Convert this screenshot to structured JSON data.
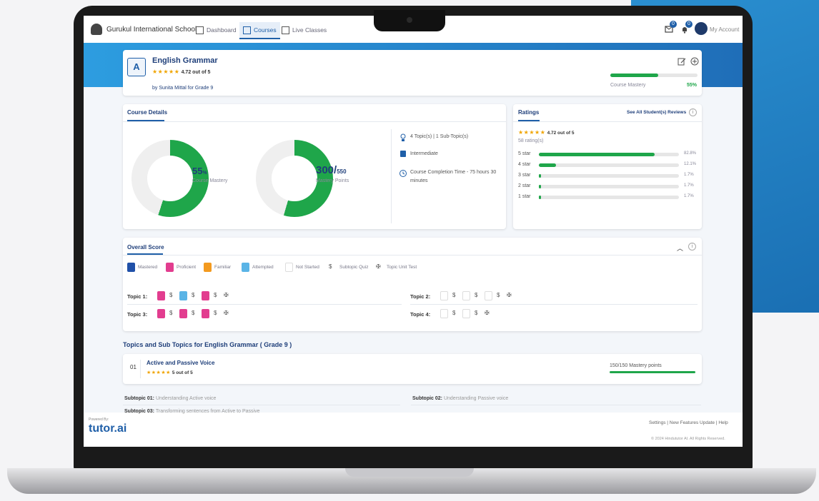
{
  "topbar": {
    "school_name": "Gurukul International School",
    "nav": [
      {
        "label": "Dashboard",
        "active": false
      },
      {
        "label": "Courses",
        "active": true
      },
      {
        "label": "Live Classes",
        "active": false
      }
    ],
    "messages_badge": "0",
    "notifications_badge": "0",
    "account_label": "My Account"
  },
  "course": {
    "title": "English Grammar",
    "stars": "★★★★★",
    "rating_text": "4.72 out of 5",
    "byline": "by Sunita Mittal for Grade 9",
    "mastery_label": "Course Mastery",
    "mastery_value": "55%",
    "mastery_fraction": 0.55
  },
  "details": {
    "title": "Course Details",
    "mastery_percent": "55",
    "percent_sign": "%",
    "mastery_label": "Course Mastery",
    "mastery_fraction": 0.55,
    "points_value": "300/",
    "points_total": "550",
    "points_label": "Mastery Points",
    "points_fraction": 0.545,
    "info": [
      "4 Topic(s) | 1 Sub-Topic(s)",
      "Intermediate",
      "Course Completion Time - 75 hours 30 minutes"
    ]
  },
  "ratings": {
    "title": "Ratings",
    "see_all": "See All Student(s) Reviews",
    "stars": "★★★★★",
    "rating_text": "4.72 out of 5",
    "count_text": "58 rating(s)",
    "rows": [
      {
        "label": "5 star",
        "pct": "82.8%",
        "fraction": 0.828
      },
      {
        "label": "4 star",
        "pct": "12.1%",
        "fraction": 0.121
      },
      {
        "label": "3 star",
        "pct": "1.7%",
        "fraction": 0.017
      },
      {
        "label": "2 star",
        "pct": "1.7%",
        "fraction": 0.017
      },
      {
        "label": "1 star",
        "pct": "1.7%",
        "fraction": 0.017
      }
    ]
  },
  "overall": {
    "title": "Overall Score",
    "legend": [
      "Mastered",
      "Proficient",
      "Familiar",
      "Attempted",
      "Not Started",
      "Subtopic Quiz",
      "Topic Unit Test"
    ],
    "quiz_symbol": "$",
    "test_symbol": "✠",
    "topics": [
      "Topic 1:",
      "Topic 2:",
      "Topic 3:",
      "Topic 4:"
    ]
  },
  "topics_section": {
    "heading": "Topics and Sub Topics for English Grammar ( Grade 9 )",
    "topic_number": "01",
    "topic_title": "Active and Passive Voice",
    "topic_stars": "★★★★★",
    "topic_rating": "5 out of 5",
    "mastery_points": "150/150 Mastery points",
    "mastery_fraction": 1.0,
    "subtopics": [
      {
        "label": "Subtopic 01:",
        "text": "Understanding Active voice"
      },
      {
        "label": "Subtopic 02:",
        "text": "Understanding Passive voice"
      },
      {
        "label": "Subtopic 03:",
        "text": "Transforming sentences from Active to Passive"
      }
    ]
  },
  "footer": {
    "powered_by": "Powered By:",
    "brand": "tutor.ai",
    "links": "Settings | New Features Update | Help",
    "copyright": "© 2024 Hindututor AI. All Rights Reserved."
  },
  "colors": {
    "accent": "#1f5fa8",
    "green": "#1fa64a",
    "pink": "#e23d8f",
    "blue": "#5ab4e6",
    "orange": "#f39a1f"
  }
}
